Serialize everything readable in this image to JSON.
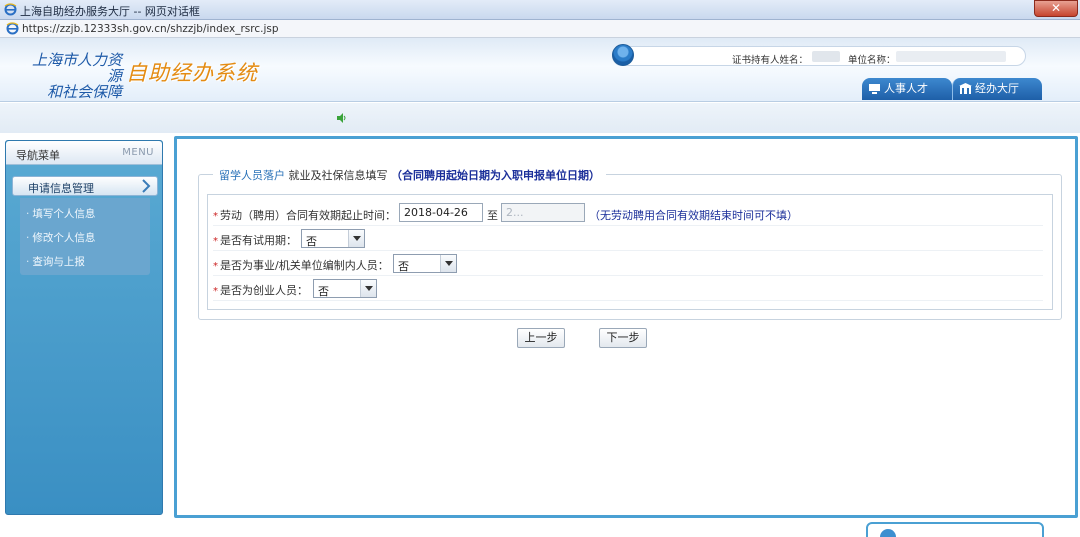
{
  "window": {
    "title": "上海自助经办服务大厅 -- 网页对话框",
    "close_label": "✕",
    "url": "https://zzjb.12333sh.gov.cn/shzzjb/index_rsrc.jsp"
  },
  "header": {
    "org_name_line1": "上海市人力资源",
    "org_name_line2": "和社会保障",
    "system_name": "自助经办系统",
    "holder_label": "证书持有人姓名：",
    "unit_label": "单位名称：",
    "tabs": [
      {
        "label": "人事人才"
      },
      {
        "label": "经办大厅"
      }
    ]
  },
  "sidebar": {
    "title": "导航菜单",
    "title_en": "MENU",
    "group_label": "申请信息管理",
    "items": [
      {
        "label": "填写个人信息"
      },
      {
        "label": "修改个人信息"
      },
      {
        "label": "查询与上报"
      }
    ]
  },
  "form": {
    "legend_part1": "留学人员落户",
    "legend_part2": "就业及社保信息填写",
    "legend_part3": "（合同聘用起始日期为入职申报单位日期）",
    "rows": [
      {
        "label": "劳动（聘用）合同有效期起止时间：",
        "start": "2018-04-26",
        "to": "至",
        "end": "2...",
        "note": "（无劳动聘用合同有效期结束时间可不填）"
      },
      {
        "label": "是否有试用期：",
        "value": "否"
      },
      {
        "label": "是否为事业/机关单位编制内人员：",
        "value": "否"
      },
      {
        "label": "是否为创业人员：",
        "value": "否"
      }
    ],
    "required_mark": "*",
    "prev_button": "上一步",
    "next_button": "下一步"
  },
  "colors": {
    "accent_blue": "#4aa0d3",
    "legend_blue": "#2a72b8",
    "note_navy": "#1b2f9a",
    "system_orange": "#e48b12",
    "required_red": "#cc2222"
  },
  "icons": [
    "ie-icon",
    "close-icon",
    "user-avatar-icon",
    "monitor-icon",
    "building-icon",
    "speaker-icon",
    "chevron-right-icon"
  ]
}
